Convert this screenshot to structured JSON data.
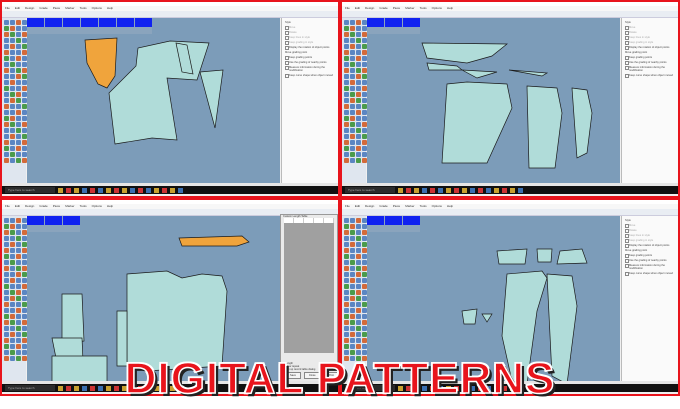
{
  "headline": "DIGITAL PATTERNS",
  "colors": {
    "frame": "#e8141c",
    "canvas": "#7c9cb9",
    "piece": "#b0dcd9",
    "selected_piece": "#f0a43c",
    "strip_cell": "#1022f0"
  },
  "window": {
    "menu": [
      "File",
      "Edit",
      "Design",
      "Grade",
      "Piece",
      "Marker",
      "Tools",
      "Options",
      "Help"
    ],
    "taskbar_search": "Type here to search"
  },
  "panel": {
    "title": "Style",
    "options": [
      "Move",
      "Rotate",
      "Keep lines in style",
      "Keep grading in style",
      "Display the rotation of object points",
      "Keep grading points",
      "Use the grading of nearby points",
      "Measure information during the modification",
      "Keep curve shape when object moved"
    ],
    "section": "Move grading point"
  },
  "dialog": {
    "title": "Custom Length Table",
    "options": [
      "Length",
      "Allow repeat",
      "Pop up record table dialog"
    ],
    "buttons": [
      "Save",
      "Close",
      "Print"
    ]
  }
}
